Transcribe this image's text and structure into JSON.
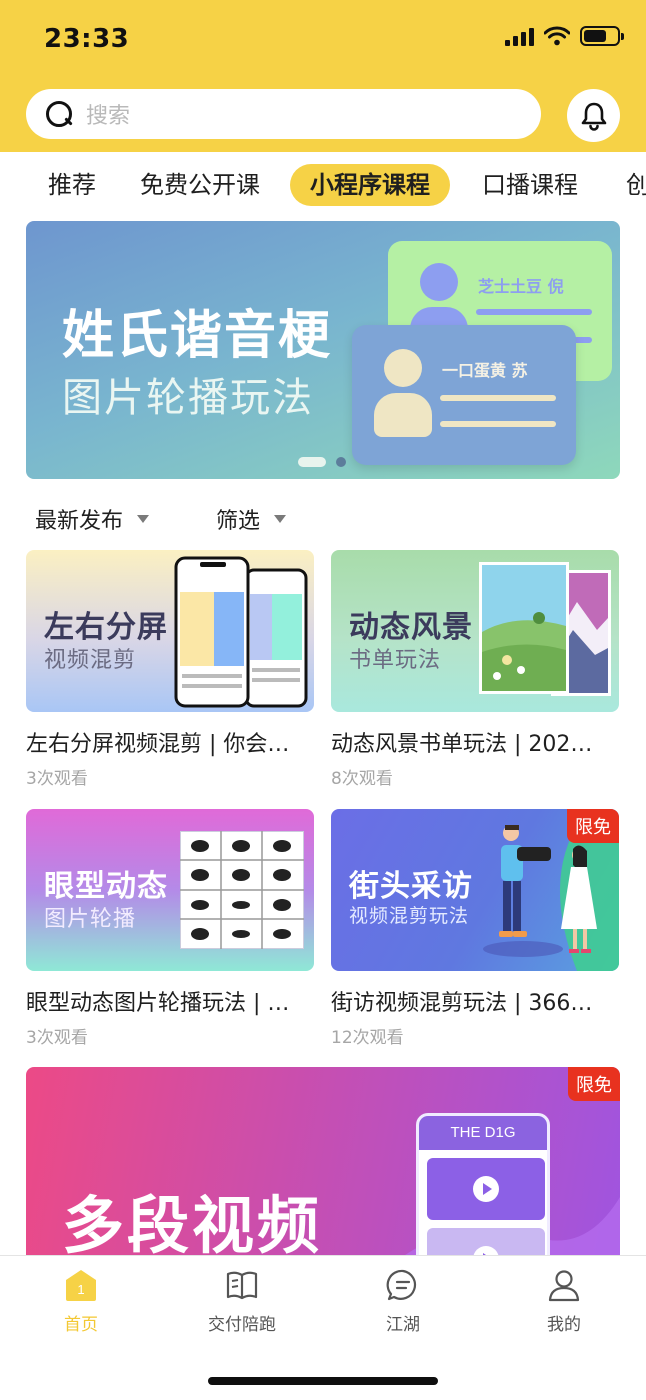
{
  "status_bar": {
    "time": "23:33"
  },
  "search": {
    "placeholder": "搜索"
  },
  "tabs": [
    {
      "label": "推荐"
    },
    {
      "label": "免费公开课"
    },
    {
      "label": "小程序课程",
      "active": true
    },
    {
      "label": "口播课程"
    },
    {
      "label": "创"
    }
  ],
  "banner": {
    "title": "姓氏谐音梗",
    "subtitle": "图片轮播玩法",
    "card_top_name": "芝士土豆 倪",
    "card_bottom_name": "一口蛋黄 苏"
  },
  "filters": {
    "sort_label": "最新发布",
    "filter_label": "筛选"
  },
  "courses": [
    {
      "thumb_title": "左右分屏",
      "thumb_sub": "视频混剪",
      "title": "左右分屏视频混剪 | 你会…",
      "views": "3次观看"
    },
    {
      "thumb_title": "动态风景",
      "thumb_sub": "书单玩法",
      "title": "动态风景书单玩法 | 202…",
      "views": "8次观看"
    },
    {
      "thumb_title": "眼型动态",
      "thumb_sub": "图片轮播",
      "title": "眼型动态图片轮播玩法 | …",
      "views": "3次观看"
    },
    {
      "thumb_title": "街头采访",
      "thumb_sub": "视频混剪玩法",
      "title": "街访视频混剪玩法 | 366…",
      "views": "12次观看",
      "badge": "限免"
    }
  ],
  "promo": {
    "title": "多段视频",
    "badge": "限免",
    "phone_header": "THE D1G"
  },
  "bottom_nav": {
    "home_badge": "1",
    "items": [
      {
        "label": "首页",
        "active": true
      },
      {
        "label": "交付陪跑"
      },
      {
        "label": "江湖"
      },
      {
        "label": "我的"
      }
    ]
  },
  "colors": {
    "brand_yellow": "#f6d246",
    "badge_red": "#e8321f",
    "muted_text": "#a6a6a6"
  }
}
